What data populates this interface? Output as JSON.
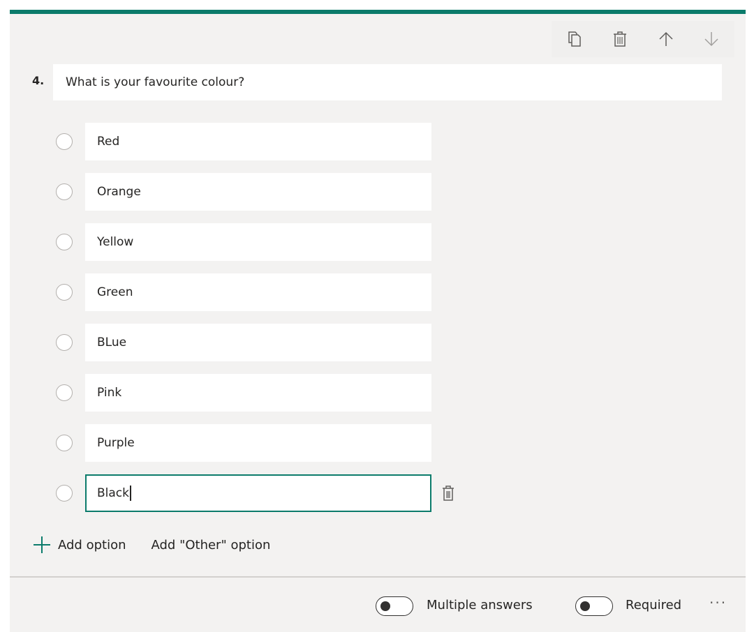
{
  "question": {
    "number": "4.",
    "title": "What is your favourite colour?"
  },
  "toolbar": {
    "icons": [
      "copy-icon",
      "delete-icon",
      "move-up-icon",
      "move-down-icon"
    ]
  },
  "options": [
    {
      "label": "Red"
    },
    {
      "label": "Orange"
    },
    {
      "label": "Yellow"
    },
    {
      "label": "Green"
    },
    {
      "label": "BLue"
    },
    {
      "label": "Pink"
    },
    {
      "label": "Purple"
    },
    {
      "label": "Black",
      "active": true
    }
  ],
  "actions": {
    "add_option": "Add option",
    "add_other": "Add \"Other\" option"
  },
  "footer": {
    "multiple_answers_label": "Multiple answers",
    "multiple_answers_on": false,
    "required_label": "Required",
    "required_on": false,
    "more": "···"
  },
  "colors": {
    "accent": "#0b7b6b",
    "card_bg": "#f3f2f1",
    "input_bg": "#ffffff"
  }
}
